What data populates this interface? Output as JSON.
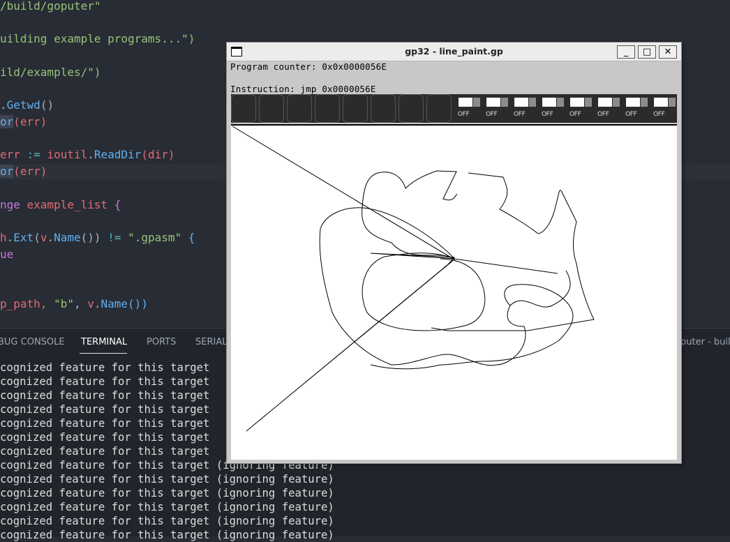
{
  "editor": {
    "lines": [
      [
        {
          "t": "/build/goputer\"",
          "c": "str"
        }
      ],
      [
        {
          "t": "uilding example programs...\")",
          "c": "str"
        }
      ],
      [
        {
          "t": "ild/examples/\")",
          "c": "str"
        }
      ],
      [
        {
          "t": ".",
          "c": "plain"
        },
        {
          "t": "Getwd",
          "c": "fn"
        },
        {
          "t": "()",
          "c": "plain"
        }
      ],
      [
        {
          "t": "or",
          "c": "sel"
        },
        {
          "t": "(err)",
          "c": "var"
        }
      ],
      [
        {
          "t": "err ",
          "c": "var"
        },
        {
          "t": ":= ",
          "c": "op"
        },
        {
          "t": "ioutil",
          "c": "var"
        },
        {
          "t": ".",
          "c": "plain"
        },
        {
          "t": "ReadDir",
          "c": "fn"
        },
        {
          "t": "(dir)",
          "c": "var"
        }
      ],
      [
        {
          "t": "or",
          "c": "sel"
        },
        {
          "t": "(err)",
          "c": "var"
        }
      ],
      [
        {
          "t": "nge ",
          "c": "kw"
        },
        {
          "t": "example_list ",
          "c": "var"
        },
        {
          "t": "{",
          "c": "kw"
        }
      ],
      [
        {
          "t": "h",
          "c": "var"
        },
        {
          "t": ".",
          "c": "plain"
        },
        {
          "t": "Ext",
          "c": "fn"
        },
        {
          "t": "(",
          "c": "plain"
        },
        {
          "t": "v",
          "c": "var"
        },
        {
          "t": ".",
          "c": "plain"
        },
        {
          "t": "Name",
          "c": "fn"
        },
        {
          "t": "()) ",
          "c": "plain"
        },
        {
          "t": "!= ",
          "c": "op"
        },
        {
          "t": "\".gpasm\" ",
          "c": "str"
        },
        {
          "t": "{",
          "c": "fn"
        }
      ],
      [
        {
          "t": "ue",
          "c": "kw"
        }
      ],
      [
        {
          "t": "p_path, ",
          "c": "var"
        },
        {
          "t": "\"b\"",
          "c": "str"
        },
        {
          "t": ", ",
          "c": "plain"
        },
        {
          "t": "v",
          "c": "var"
        },
        {
          "t": ".",
          "c": "plain"
        },
        {
          "t": "Name",
          "c": "fn"
        },
        {
          "t": "())",
          "c": "fn"
        }
      ]
    ]
  },
  "panel": {
    "tabs": [
      {
        "label": "BUG CONSOLE",
        "active": false
      },
      {
        "label": "TERMINAL",
        "active": true
      },
      {
        "label": "PORTS",
        "active": false
      },
      {
        "label": "SERIAL",
        "active": false
      }
    ],
    "terminal_title": "puter - buil",
    "terminal_lines": [
      "cognized feature for this target",
      "cognized feature for this target",
      "cognized feature for this target",
      "cognized feature for this target",
      "cognized feature for this target",
      "cognized feature for this target",
      "cognized feature for this target",
      "cognized feature for this target (ignoring feature)",
      "cognized feature for this target (ignoring feature)",
      "cognized feature for this target (ignoring feature)",
      "cognized feature for this target (ignoring feature)",
      "cognized feature for this target (ignoring feature)",
      "cognized feature for this target (ignoring feature)"
    ]
  },
  "gp32": {
    "title": "gp32 - line_paint.gp",
    "minimize": "_",
    "maximize": "□",
    "close": "✕",
    "program_counter": "Program counter: 0x0x0000056E",
    "instruction": "Instruction: jmp 0x0000056E",
    "led_label": "OFF",
    "led_count": 8,
    "empty_slots": 8
  },
  "colors": {
    "editor_bg": "#282c34",
    "panel_bg": "#21252b",
    "string": "#98c379",
    "function": "#61afef",
    "keyword": "#c678dd",
    "variable": "#e06c75",
    "operator": "#56b6c2"
  }
}
